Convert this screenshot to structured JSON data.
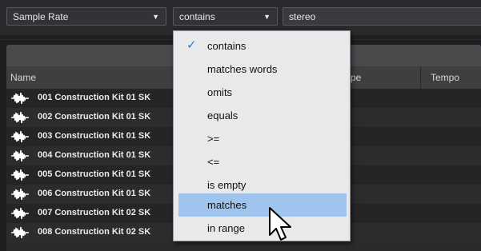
{
  "filter": {
    "attribute_value": "Sample Rate",
    "operator_value": "contains",
    "search_value": "stereo"
  },
  "columns": {
    "name": "Name",
    "type_partial": "pe",
    "tempo": "Tempo"
  },
  "rows": [
    {
      "name": "001 Construction Kit 01 SK"
    },
    {
      "name": "002 Construction Kit 01 SK"
    },
    {
      "name": "003 Construction Kit 01 SK"
    },
    {
      "name": "004 Construction Kit 01 SK"
    },
    {
      "name": "005 Construction Kit 01 SK"
    },
    {
      "name": "006 Construction Kit 01 SK"
    },
    {
      "name": "007 Construction Kit 02 SK"
    },
    {
      "name": "008 Construction Kit 02 SK",
      "rating": "***",
      "media_type": "Audio"
    }
  ],
  "operator_menu": {
    "items": [
      "contains",
      "matches words",
      "omits",
      "equals",
      ">=",
      "<=",
      "is empty",
      "matches",
      "in range"
    ],
    "selected": "contains",
    "hovered": "matches"
  },
  "colors": {
    "menu_highlight": "#9fc4ee",
    "check": "#2f7fd0",
    "list_background": "#252527"
  },
  "icons": {
    "dropdown": "triangle-down-icon",
    "row": "audio-waveform-icon",
    "check": "checkmark-icon",
    "cursor": "mouse-pointer-icon"
  }
}
